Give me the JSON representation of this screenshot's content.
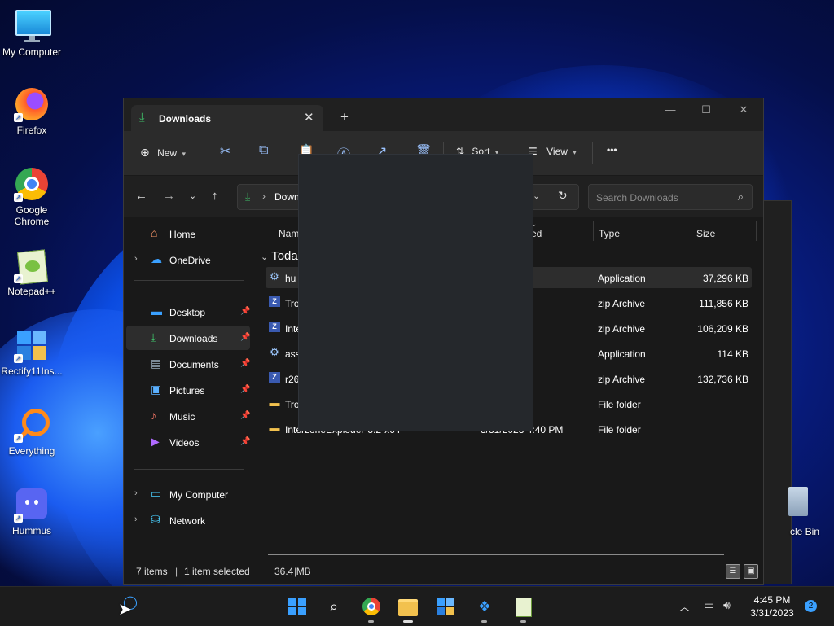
{
  "desktop": {
    "icons": [
      {
        "label": "My Computer",
        "icon": "monitor-icon"
      },
      {
        "label": "Firefox",
        "icon": "firefox-icon"
      },
      {
        "label": "Google Chrome",
        "icon": "chrome-icon"
      },
      {
        "label": "Notepad++",
        "icon": "notepadpp-icon"
      },
      {
        "label": "Rectify11Ins...",
        "icon": "installer-icon"
      },
      {
        "label": "Everything",
        "icon": "magnifier-icon"
      },
      {
        "label": "Hummus",
        "icon": "discord-icon"
      }
    ],
    "recycle_bin_label": "cle Bin"
  },
  "window": {
    "tab_title": "Downloads",
    "tab_close": "✕",
    "new_tab": "+",
    "controls": {
      "minimize": "—",
      "maximize": "☐",
      "close": "✕"
    },
    "toolbar": {
      "new_label": "New",
      "sort_label": "Sort",
      "view_label": "View",
      "more": "•••"
    },
    "address": {
      "crumb": "Down",
      "separator": "›"
    },
    "search_placeholder": "Search Downloads",
    "nav": {
      "home": "Home",
      "onedrive": "OneDrive",
      "desktop": "Desktop",
      "downloads": "Downloads",
      "documents": "Documents",
      "pictures": "Pictures",
      "music": "Music",
      "videos": "Videos",
      "my_computer": "My Computer",
      "network": "Network"
    },
    "columns": {
      "name": "Nam",
      "date": "ed",
      "type": "Type",
      "size": "Size"
    },
    "group_label": "Toda",
    "files": [
      {
        "name": "hu",
        "date": "43 PM",
        "type": "Application",
        "size": "37,296 KB",
        "icon": "app-icon",
        "selected": true
      },
      {
        "name": "Tro",
        "date": "40 PM",
        "type": "zip Archive",
        "size": "111,856 KB",
        "icon": "zip-icon"
      },
      {
        "name": "Inte",
        "date": "38 PM",
        "type": "zip Archive",
        "size": "106,209 KB",
        "icon": "zip-icon"
      },
      {
        "name": "ass",
        "date": "34 PM",
        "type": "Application",
        "size": "114 KB",
        "icon": "app-icon"
      },
      {
        "name": "r26",
        "date": "31 PM",
        "type": "zip Archive",
        "size": "132,736 KB",
        "icon": "zip-icon"
      },
      {
        "name": "Tro",
        "date": "40 PM",
        "type": "File folder",
        "size": "",
        "icon": "folder-icon"
      },
      {
        "name": "InterzoneExploder-3.2-x64",
        "date": "3/31/2023 4:40 PM",
        "type": "File folder",
        "size": "",
        "icon": "folder-icon"
      }
    ],
    "status": {
      "items": "7 items",
      "selected": "1 item selected",
      "size": "36.4 MB"
    }
  },
  "taskbar": {
    "time": "4:45 PM",
    "date": "3/31/2023",
    "notification_count": "2"
  },
  "colors": {
    "accent": "#3aa0ff",
    "download_green": "#3fc26a",
    "folder_yellow": "#f2c14e"
  }
}
